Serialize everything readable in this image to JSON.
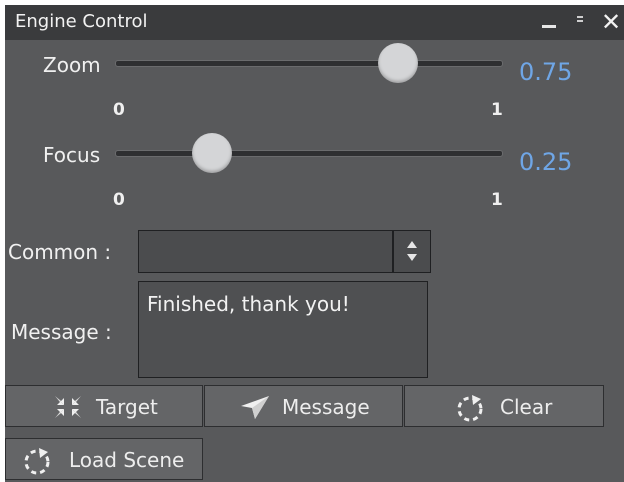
{
  "window": {
    "title": "Engine Control",
    "controls": [
      "minimize-icon",
      "maximize-icon",
      "close-icon"
    ],
    "close_glyph": "✕"
  },
  "sliders": [
    {
      "label": "Zoom",
      "min_label": "0",
      "max_label": "1",
      "value": 0.75,
      "value_text": "0.75"
    },
    {
      "label": "Focus",
      "min_label": "0",
      "max_label": "1",
      "value": 0.25,
      "value_text": "0.25"
    }
  ],
  "common": {
    "label": "Common :",
    "value": ""
  },
  "message": {
    "label": "Message :",
    "value": "Finished, thank you!"
  },
  "buttons": {
    "target": "Target",
    "message": "Message",
    "clear": "Clear",
    "load_scene": "Load Scene"
  },
  "colors": {
    "panel": "#58595b",
    "titlebar": "#3a3b3d",
    "value_text": "#6fa6e6",
    "button": "#646567"
  }
}
